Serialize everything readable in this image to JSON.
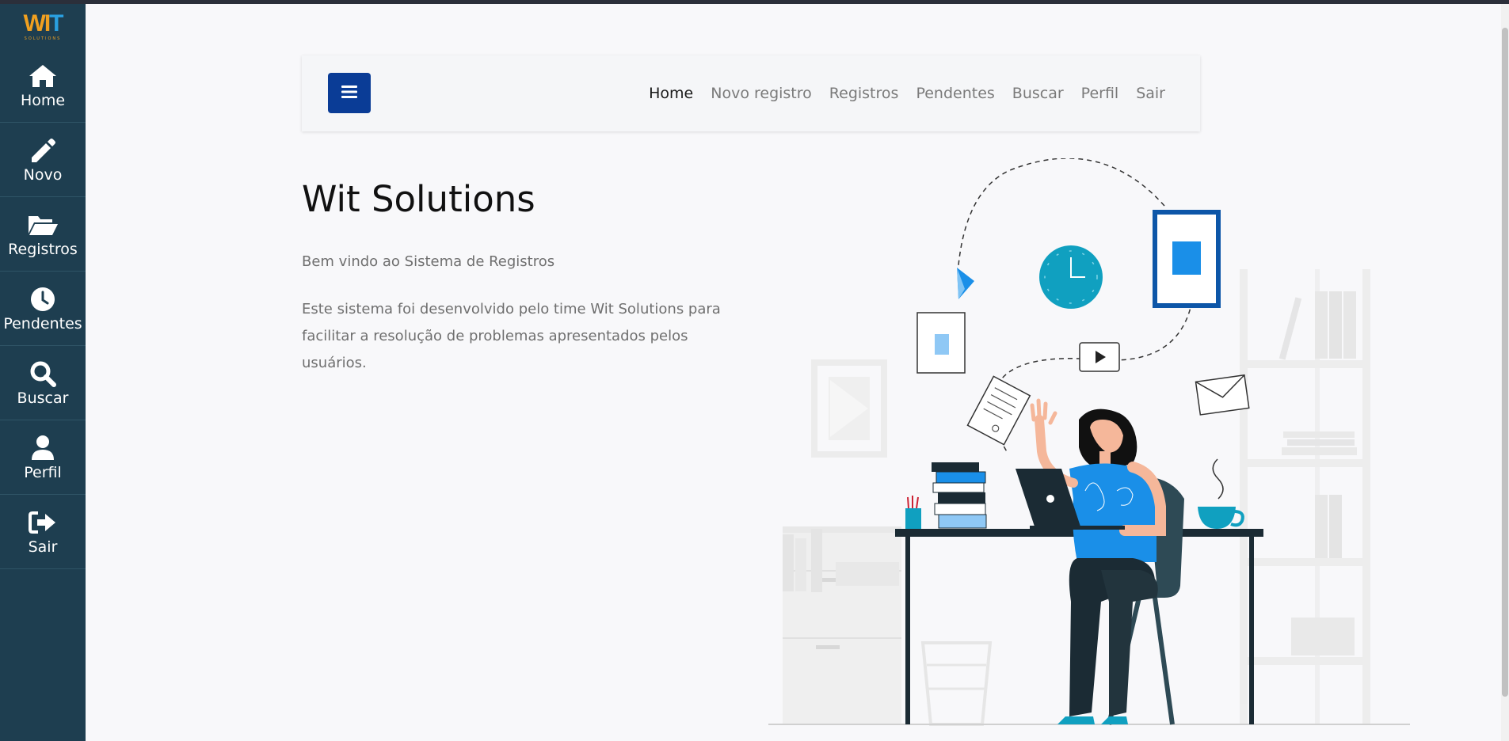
{
  "logo": {
    "mark_w": "W",
    "mark_i": "I",
    "mark_t": "T",
    "subtitle": "SOLUTIONS"
  },
  "sidebar": {
    "items": [
      {
        "label": "Home",
        "icon": "home-icon"
      },
      {
        "label": "Novo",
        "icon": "pencil-icon"
      },
      {
        "label": "Registros",
        "icon": "folder-open-icon"
      },
      {
        "label": "Pendentes",
        "icon": "clock-icon"
      },
      {
        "label": "Buscar",
        "icon": "search-icon"
      },
      {
        "label": "Perfil",
        "icon": "user-icon"
      },
      {
        "label": "Sair",
        "icon": "sign-out-icon"
      }
    ]
  },
  "navbar": {
    "toggle_icon": "hamburger-menu-icon",
    "links": [
      {
        "label": "Home",
        "active": true
      },
      {
        "label": "Novo registro",
        "active": false
      },
      {
        "label": "Registros",
        "active": false
      },
      {
        "label": "Pendentes",
        "active": false
      },
      {
        "label": "Buscar",
        "active": false
      },
      {
        "label": "Perfil",
        "active": false
      },
      {
        "label": "Sair",
        "active": false
      }
    ]
  },
  "hero": {
    "title": "Wit Solutions",
    "greeting": "Bem vindo ao Sistema de Registros",
    "description": "Este sistema foi desenvolvido pelo time Wit Solutions para facilitar a resolução de problemas apresentados pelos usuários."
  },
  "colors": {
    "sidebar_bg": "#1e3e50",
    "toggle_bg": "#0a3c96",
    "accent_blue": "#1a8fe8",
    "teal": "#10a0c0",
    "logo_orange": "#f0a020"
  }
}
